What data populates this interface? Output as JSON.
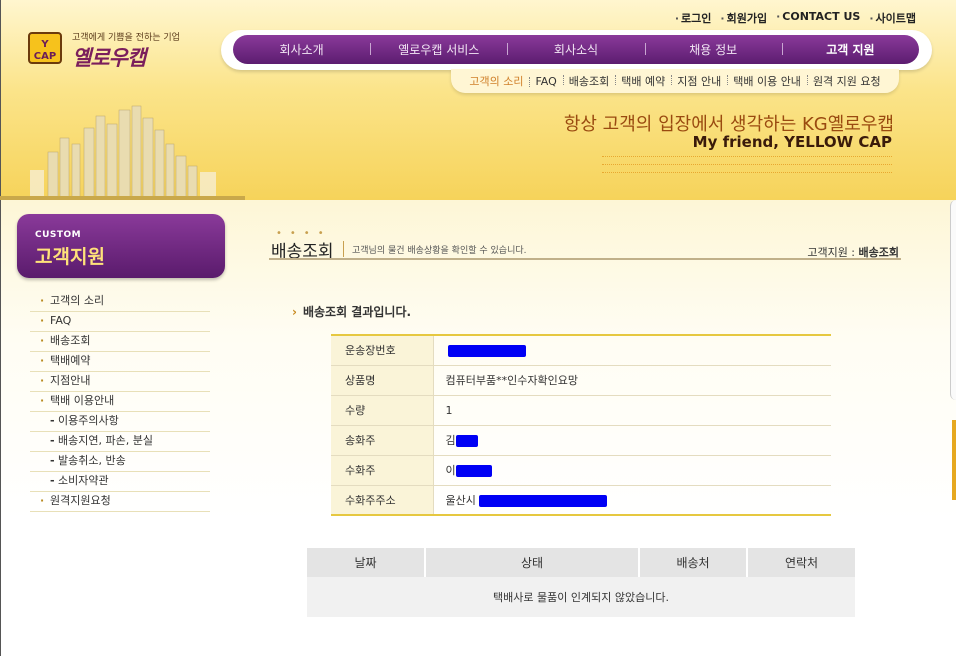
{
  "utility_links": [
    "로그인",
    "회원가입",
    "CONTACT US",
    "사이트맵"
  ],
  "logo": {
    "tagline": "고객에게 기쁨을 전하는 기업",
    "name": "옐로우캡",
    "cap_text": "YELLOW CAP"
  },
  "main_nav": [
    "회사소개",
    "옐로우캡 서비스",
    "회사소식",
    "채용 정보",
    "고객 지원"
  ],
  "sub_nav": [
    "고객의 소리",
    "FAQ",
    "배송조회",
    "택배 예약",
    "지점 안내",
    "택배 이용 안내",
    "원격 지원 요청"
  ],
  "hero": {
    "slogan": "항상 고객의 입장에서 생각하는 KG옐로우캡",
    "sub": "My friend, YELLOW CAP"
  },
  "sidebar": {
    "title_en": "CUSTOM",
    "title_ko": "고객지원",
    "items": [
      {
        "label": "고객의 소리",
        "sub": false
      },
      {
        "label": "FAQ",
        "sub": false
      },
      {
        "label": "배송조회",
        "sub": false
      },
      {
        "label": "택배예약",
        "sub": false
      },
      {
        "label": "지점안내",
        "sub": false
      },
      {
        "label": "택배 이용안내",
        "sub": false
      },
      {
        "label": "이용주의사항",
        "sub": true
      },
      {
        "label": "배송지연, 파손, 분실",
        "sub": true
      },
      {
        "label": "발송취소, 반송",
        "sub": true
      },
      {
        "label": "소비자약관",
        "sub": true
      },
      {
        "label": "원격지원요청",
        "sub": false
      }
    ]
  },
  "page": {
    "title": "배송조회",
    "description": "고객님의 물건 배송상황을 확인할 수 있습니다.",
    "breadcrumb_prefix": "고객지원 :",
    "breadcrumb_current": "배송조회",
    "result_heading": "배송조회 결과입니다."
  },
  "info_table": {
    "rows": [
      {
        "label": "운송장번호",
        "value": ""
      },
      {
        "label": "상품명",
        "value": "컴퓨터부품**인수자확인요망"
      },
      {
        "label": "수량",
        "value": "1"
      },
      {
        "label": "송화주",
        "value": "김"
      },
      {
        "label": "수화주",
        "value": "이"
      },
      {
        "label": "수화주주소",
        "value": "울산시"
      }
    ]
  },
  "track_table": {
    "headers": [
      "날짜",
      "상태",
      "배송처",
      "연락처"
    ],
    "empty_message": "택배사로 물품이 인계되지 않았습니다."
  },
  "colors": {
    "purple": "#6b1d7c",
    "yellow": "#f6d35a",
    "redaction": "#0000f5"
  }
}
